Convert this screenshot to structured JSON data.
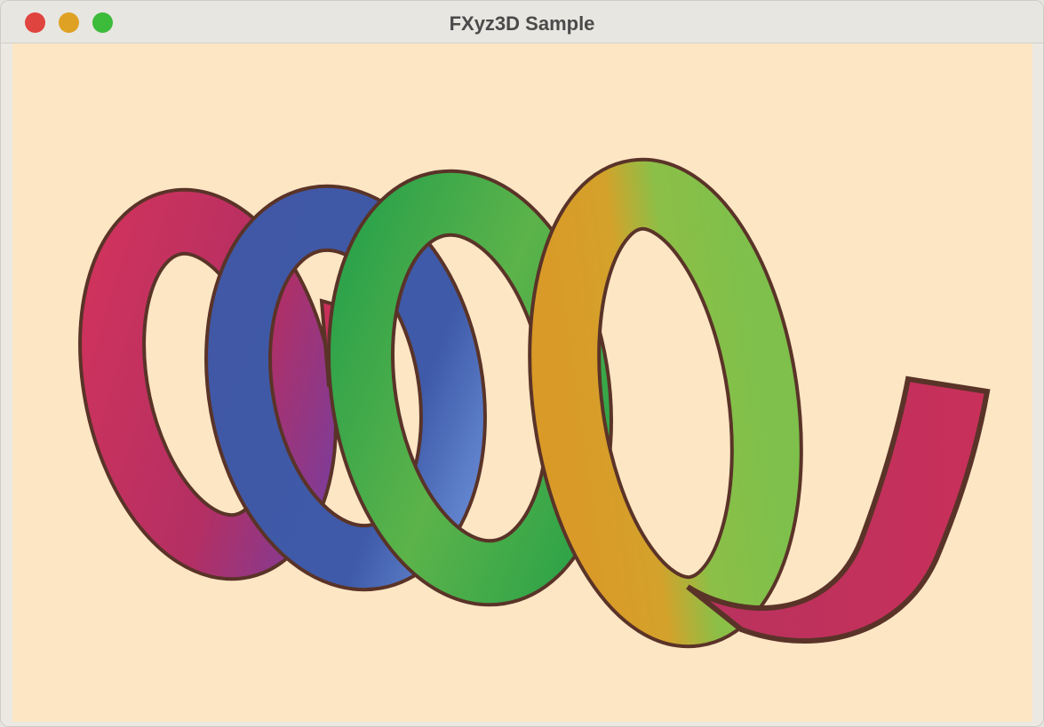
{
  "window": {
    "title": "FXyz3D Sample",
    "buttons": {
      "close_color": "#e0443e",
      "minimize_color": "#dea123",
      "zoom_color": "#3dbb3b"
    }
  },
  "scene": {
    "background_color": "#fde6c4",
    "outline_color": "#5a3328",
    "object": "spring-helix",
    "coil_count": 4,
    "coils": [
      {
        "name": "coil-1",
        "colors": [
          "#c8305a",
          "#7a3d9c"
        ]
      },
      {
        "name": "coil-2",
        "colors": [
          "#3d5aa8",
          "#5c7fd0"
        ]
      },
      {
        "name": "coil-3",
        "colors": [
          "#27a148",
          "#7bbd45"
        ]
      },
      {
        "name": "coil-4",
        "colors": [
          "#d99a27",
          "#7ec04b",
          "#c8305a"
        ]
      }
    ]
  }
}
